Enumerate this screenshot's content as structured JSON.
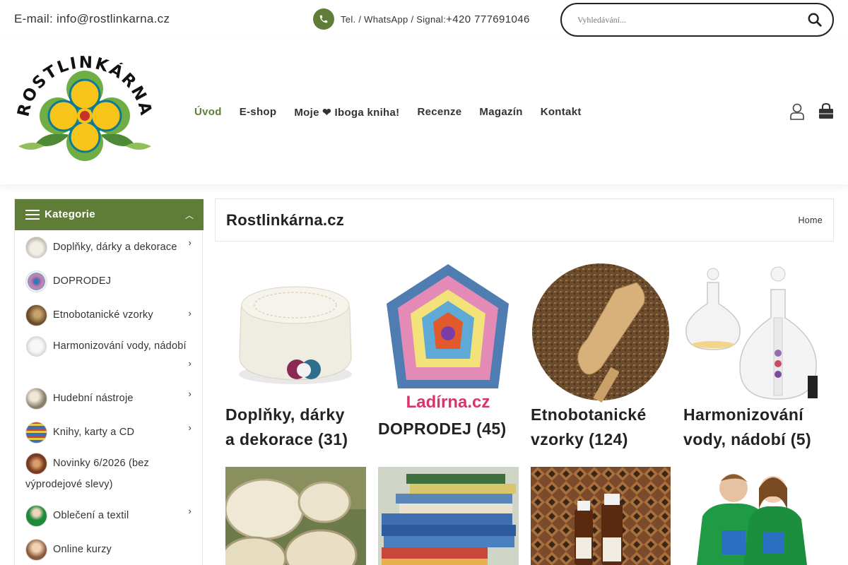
{
  "topbar": {
    "email": "E-mail: info@rostlinkarna.cz",
    "phone_label": "Tel. / WhatsApp / Signal:",
    "phone_number": "+420 777691046",
    "search_placeholder": "Vyhledávání..."
  },
  "logo": {
    "text": "ROSTLINKÁRNA"
  },
  "nav": {
    "items": [
      {
        "label": "Úvod",
        "active": true
      },
      {
        "label": "E-shop"
      },
      {
        "label": "Moje ❤ Iboga kniha!"
      },
      {
        "label": "Recenze"
      },
      {
        "label": "Magazín"
      },
      {
        "label": "Kontakt"
      }
    ]
  },
  "sidebar": {
    "title": "Kategorie",
    "items": [
      {
        "label": "Doplňky, dárky a dekorace",
        "has_sub": true
      },
      {
        "label": "DOPRODEJ",
        "has_sub": false
      },
      {
        "label": "Etnobotanické vzorky",
        "has_sub": true
      },
      {
        "label": "Harmonizování vody, nádobí",
        "has_sub": true
      },
      {
        "label": "Hudební nástroje",
        "has_sub": true
      },
      {
        "label": "Knihy, karty a CD",
        "has_sub": true
      },
      {
        "label": "Novinky 6/2026 (bez výprodejové slevy)",
        "has_sub": false
      },
      {
        "label": "Oblečení a textil",
        "has_sub": true
      },
      {
        "label": "Online kurzy",
        "has_sub": false
      }
    ]
  },
  "page": {
    "title": "Rostlinkárna.cz",
    "breadcrumb": "Home"
  },
  "products": [
    {
      "name": "Doplňky, dárky a dekorace (31)",
      "line1": "Doplňky, dárky",
      "line2": "a dekorace (31)"
    },
    {
      "name": "DOPRODEJ (45)",
      "line1": "DOPRODEJ (45)",
      "line2": "",
      "img_caption": "Ladírna.cz"
    },
    {
      "name": "Etnobotanické vzorky (124)",
      "line1": "Etnobotanické",
      "line2": "vzorky (124)"
    },
    {
      "name": "Harmonizování vody, nádobí (5)",
      "line1": "Harmonizování",
      "line2": "vody, nádobí (5)"
    }
  ],
  "colors": {
    "accent": "#5f7d36",
    "text": "#222222"
  }
}
